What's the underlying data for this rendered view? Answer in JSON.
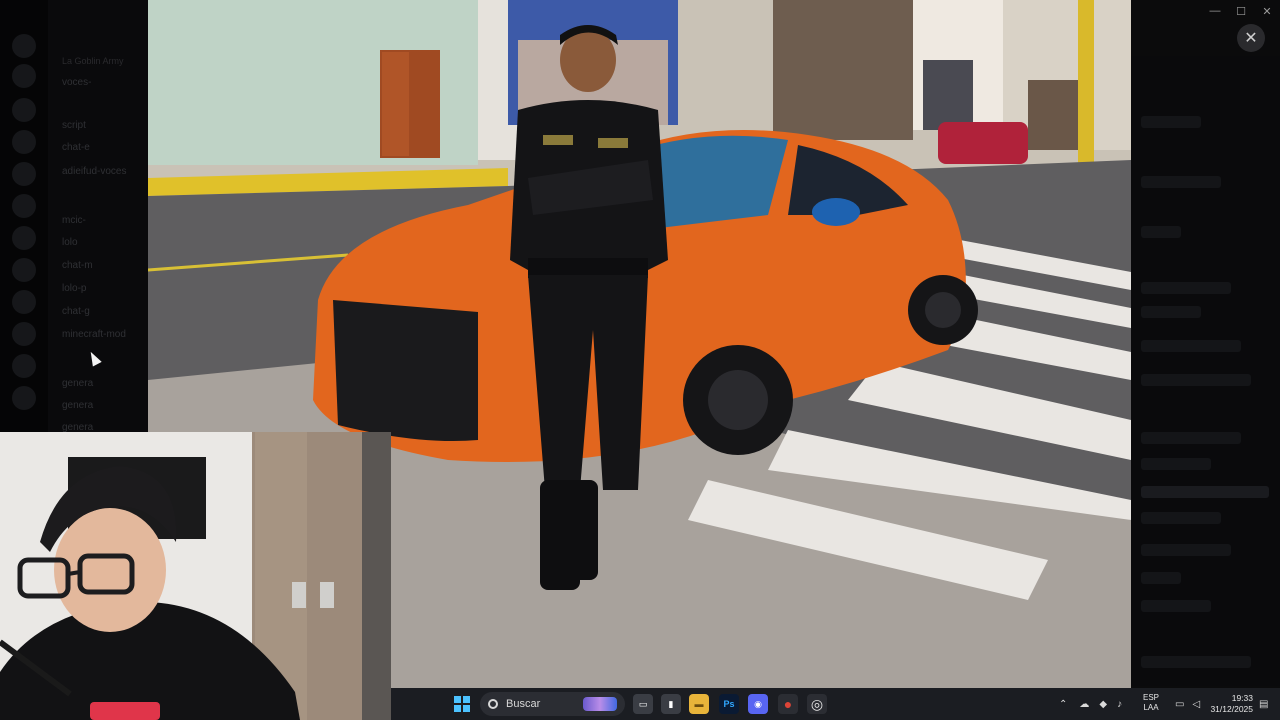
{
  "window": {
    "minimize": "—",
    "maximize": "☐",
    "close": "✕",
    "viewer_close": "✕"
  },
  "discord": {
    "server_name": "La Goblin Army",
    "channels": [
      "voces-",
      "",
      "script",
      "chat-e",
      "adieifud-voces",
      "",
      "mcic-",
      "lolo",
      "chat-m",
      "lolo-p",
      "chat-g",
      "minecraft-mod",
      "",
      "genera",
      "genera",
      "genera"
    ]
  },
  "taskbar": {
    "search_placeholder": "Buscar",
    "apps": [
      {
        "name": "task-view",
        "glyph": "▭",
        "color": "#3a3d44"
      },
      {
        "name": "app-icon",
        "glyph": "▮",
        "color": "#3a3d44"
      },
      {
        "name": "file-explorer",
        "glyph": "▬",
        "color": "#e8b43a"
      },
      {
        "name": "photoshop",
        "glyph": "Ps",
        "color": "#0a1a33"
      },
      {
        "name": "discord",
        "glyph": "◉",
        "color": "#5865f2"
      },
      {
        "name": "chrome",
        "glyph": "●",
        "color": "#dc4437"
      },
      {
        "name": "obs",
        "glyph": "◎",
        "color": "#2b2d33"
      }
    ],
    "language_top": "ESP",
    "language_bottom": "LAA",
    "time": "19:33",
    "date": "31/12/2025"
  }
}
